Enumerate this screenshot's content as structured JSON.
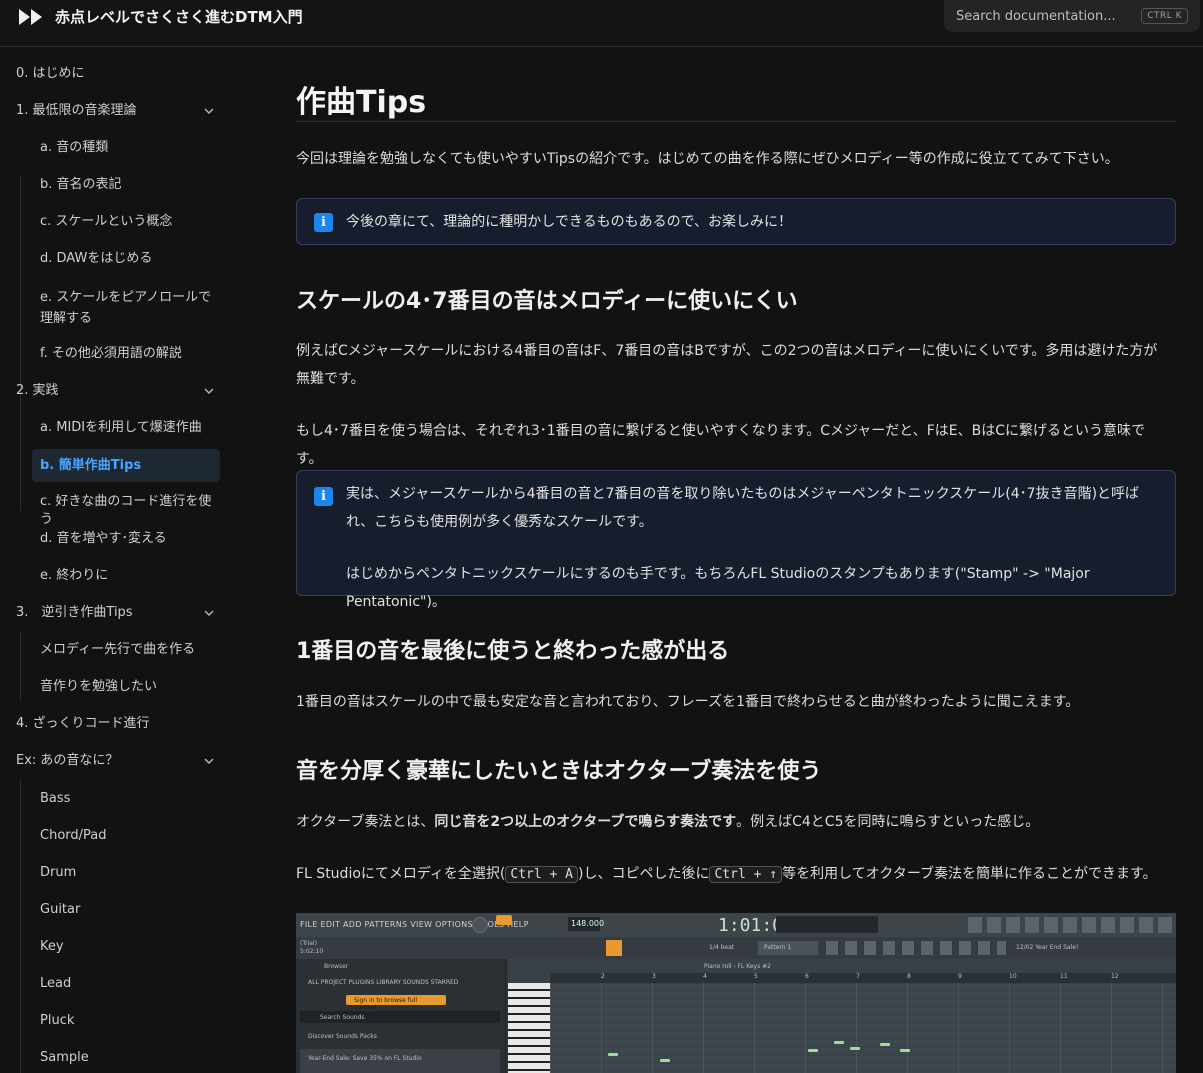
{
  "header": {
    "site_title": "赤点レベルでさくさく進むDTM入門",
    "search_placeholder": "Search documentation...",
    "search_shortcut": "CTRL K"
  },
  "sidebar": {
    "items": [
      {
        "label": "0. はじめに"
      },
      {
        "label": "1. 最低限の音楽理論"
      },
      {
        "label": "a. 音の種類"
      },
      {
        "label": "b. 音名の表記"
      },
      {
        "label": "c. スケールという概念"
      },
      {
        "label": "d. DAWをはじめる"
      },
      {
        "label": "e. スケールをピアノロールで理解する"
      },
      {
        "label": "f. その他必須用語の解説"
      },
      {
        "label": "2. 実践"
      },
      {
        "label": "a. MIDIを利用して爆速作曲"
      },
      {
        "label": "b. 簡単作曲Tips"
      },
      {
        "label": "c. 好きな曲のコード進行を使う"
      },
      {
        "label": "d. 音を増やす･変える"
      },
      {
        "label": "e. 終わりに"
      },
      {
        "label": "3.　逆引き作曲Tips"
      },
      {
        "label": "メロディー先行で曲を作る"
      },
      {
        "label": "音作りを勉強したい"
      },
      {
        "label": "4. ざっくりコード進行"
      },
      {
        "label": "Ex: あの音なに？"
      },
      {
        "label": "Bass"
      },
      {
        "label": "Chord/Pad"
      },
      {
        "label": "Drum"
      },
      {
        "label": "Guitar"
      },
      {
        "label": "Key"
      },
      {
        "label": "Lead"
      },
      {
        "label": "Pluck"
      },
      {
        "label": "Sample"
      }
    ]
  },
  "article": {
    "title": "作曲Tips",
    "intro": "今回は理論を勉強しなくても使いやすいTipsの紹介です。はじめての曲を作る際にぜひメロディー等の作成に役立ててみて下さい。",
    "callout1": "今後の章にて、理論的に種明かしできるものもあるので、お楽しみに！",
    "h2_1": "スケールの4･7番目の音はメロディーに使いにくい",
    "p1": "例えばCメジャースケールにおける4番目の音はF、7番目の音はBですが、この2つの音はメロディーに使いにくいです。多用は避けた方が無難です。",
    "p2": "もし4･7番目を使う場合は、それぞれ3･1番目の音に繋げると使いやすくなります。Cメジャーだと、FはE、BはCに繋げるという意味です。",
    "callout2_line1": "実は、メジャースケールから4番目の音と7番目の音を取り除いたものはメジャーペンタトニックスケール(4･7抜き音階)と呼ばれ、こちらも使用例が多く優秀なスケールです。",
    "callout2_line2": "はじめからペンタトニックスケールにするのも手です。もちろんFL Studioのスタンプもあります(\"Stamp\" -> \"Major Pentatonic\")。",
    "h2_2": "1番目の音を最後に使うと終わった感が出る",
    "p3": "1番目の音はスケールの中で最も安定な音と言われており、フレーズを1番目で終わらせると曲が終わったように聞こえます。",
    "h2_3": "音を分厚く豪華にしたいときはオクターブ奏法を使う",
    "p4_pre": "オクターブ奏法とは、",
    "p4_bold": "同じ音を2つ以上のオクターブで鳴らす奏法です",
    "p4_post": "。例えばC4とC5を同時に鳴らすといった感じ。",
    "p5_pre": "FL Studioにてメロディを全選択(",
    "p5_kbd1": "Ctrl + A",
    "p5_mid": ")し、コピペした後に",
    "p5_kbd2": "Ctrl + ↑",
    "p5_post": "等を利用してオクターブ奏法を簡単に作ることができます。"
  },
  "fl_screenshot": {
    "menu": "FILE EDIT ADD PATTERNS VIEW OPTIONS TOOLS HELP",
    "tempo": "148.000",
    "time": "1:01:00",
    "trial": "(Trial)",
    "trial_time": "5:02:10",
    "browser_label": "Browser",
    "browser_tabs": "ALL   PROJECT   PLUGINS   LIBRARY   SOUNDS   STARRED",
    "sign_in": "Sign in to browse full content",
    "search_sounds": "Search Sounds",
    "sub_tabs": "Discover      Sounds      Packs",
    "promo": "Year-End Sale: Save 35% on FL Studio",
    "piano_roll": "Piano roll - FL Keys #2",
    "pattern": "Pattern 1",
    "beat": "1/4 beat",
    "sale_news": "12/02 Year End Sale!",
    "bar_numbers": [
      "2",
      "3",
      "4",
      "5",
      "6",
      "7",
      "8",
      "9",
      "10",
      "11",
      "12"
    ]
  }
}
